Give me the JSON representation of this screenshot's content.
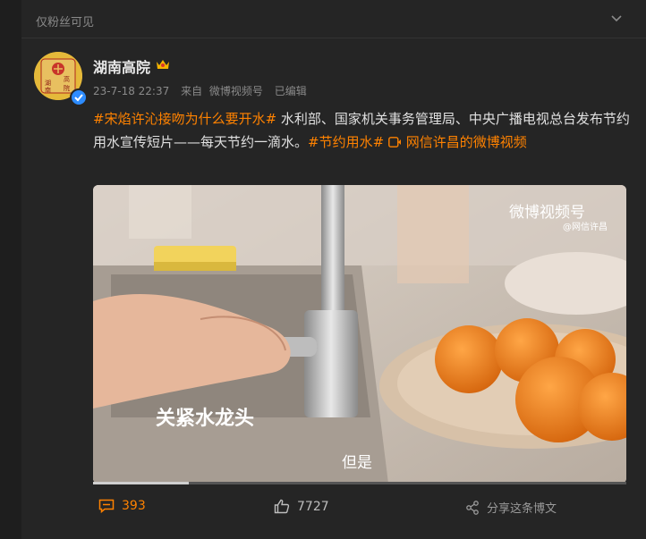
{
  "header": {
    "fans_only": "仅粉丝可见"
  },
  "user": {
    "name": "湖南高院",
    "avatar_seal_text": "湖南高院",
    "verified_color": "#2d8cff"
  },
  "meta": {
    "time": "23-7-18 22:37",
    "source_prefix": "来自",
    "source": "微博视频号",
    "edited": "已编辑"
  },
  "post": {
    "tag1": "#宋焰许沁接吻为什么要开水#",
    "text1": " 水利部、国家机关事务管理局、中央广播电视总台发布节约用水宣传短片——每天节约一滴水。",
    "tag2": "#节约用水#",
    "video_link": " 网信许昌的微博视频"
  },
  "video": {
    "watermark": "微博视频号",
    "watermark_sub": "@网信许昌",
    "caption": "关紧水龙头",
    "subtitle": "但是",
    "progress": 0.18
  },
  "actions": {
    "comments": "393",
    "likes": "7727",
    "share": "分享这条博文"
  },
  "colors": {
    "accent": "#ff8200",
    "background": "#252525"
  }
}
